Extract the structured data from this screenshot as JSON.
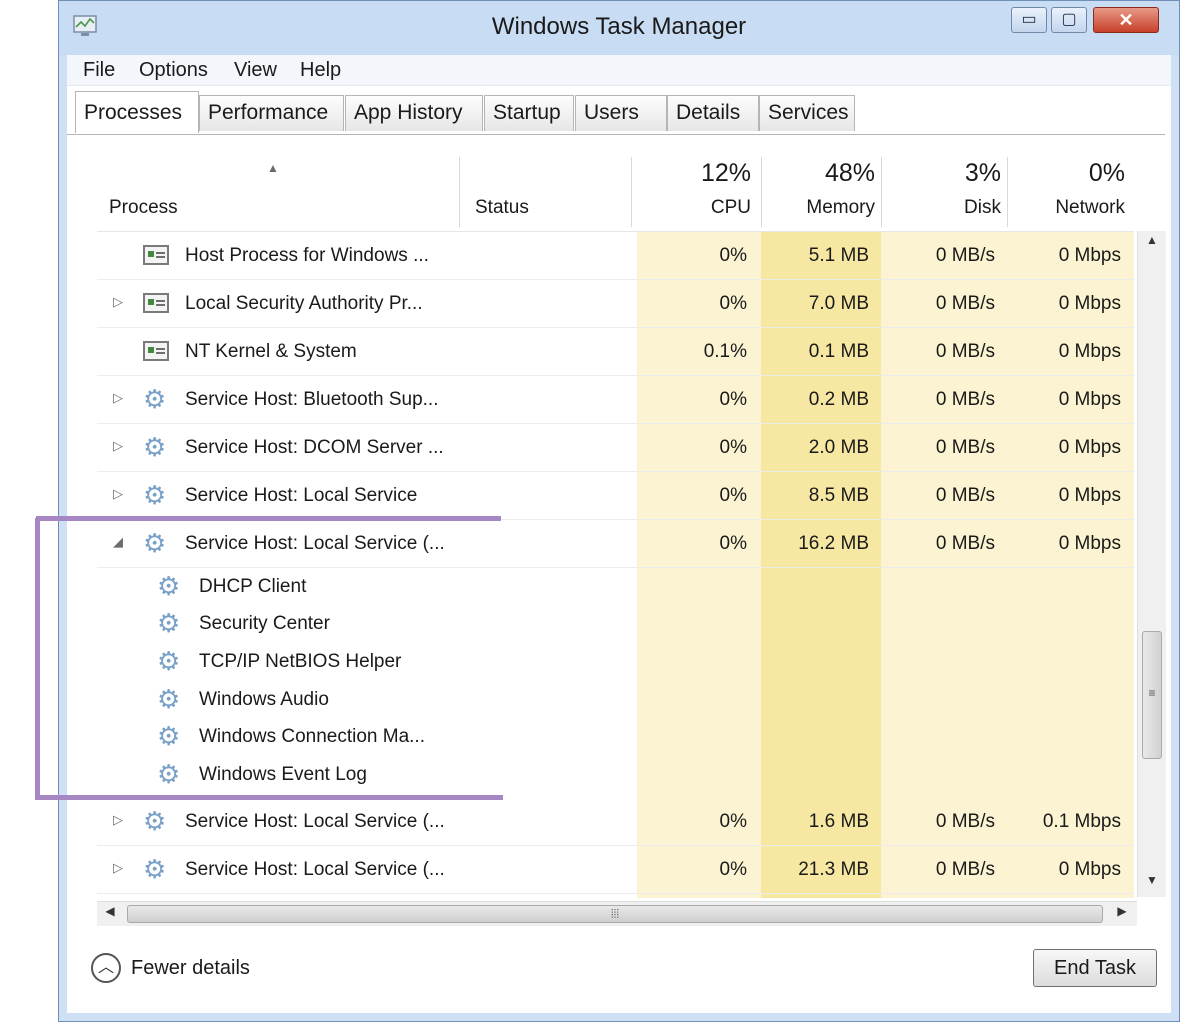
{
  "window": {
    "title": "Windows Task Manager",
    "minimize_icon": "▭",
    "maximize_icon": "▢",
    "close_icon": "✕"
  },
  "menu": [
    {
      "label": "File"
    },
    {
      "label": "Options"
    },
    {
      "label": "View"
    },
    {
      "label": "Help"
    }
  ],
  "tabs": [
    {
      "label": "Processes",
      "active": true
    },
    {
      "label": "Performance"
    },
    {
      "label": "App History"
    },
    {
      "label": "Startup"
    },
    {
      "label": "Users"
    },
    {
      "label": "Details"
    },
    {
      "label": "Services"
    }
  ],
  "columns": {
    "process": "Process",
    "status": "Status",
    "cpu_pct": "12%",
    "cpu": "CPU",
    "mem_pct": "48%",
    "mem": "Memory",
    "disk_pct": "3%",
    "disk": "Disk",
    "net_pct": "0%",
    "net": "Network"
  },
  "rows": [
    {
      "name": "Host Process for Windows ...",
      "icon": "window-icon",
      "expandable": false,
      "cpu": "0%",
      "memory": "5.1 MB",
      "disk": "0 MB/s",
      "network": "0 Mbps"
    },
    {
      "name": "Local Security Authority Pr...",
      "icon": "window-icon",
      "expandable": true,
      "cpu": "0%",
      "memory": "7.0 MB",
      "disk": "0 MB/s",
      "network": "0 Mbps"
    },
    {
      "name": "NT Kernel & System",
      "icon": "window-icon",
      "expandable": false,
      "cpu": "0.1%",
      "memory": "0.1 MB",
      "disk": "0 MB/s",
      "network": "0 Mbps"
    },
    {
      "name": "Service Host: Bluetooth Sup...",
      "icon": "gear-icon",
      "expandable": true,
      "cpu": "0%",
      "memory": "0.2 MB",
      "disk": "0 MB/s",
      "network": "0 Mbps"
    },
    {
      "name": "Service Host: DCOM Server ...",
      "icon": "gear-icon",
      "expandable": true,
      "cpu": "0%",
      "memory": "2.0 MB",
      "disk": "0 MB/s",
      "network": "0 Mbps"
    },
    {
      "name": "Service Host: Local Service",
      "icon": "gear-icon",
      "expandable": true,
      "cpu": "0%",
      "memory": "8.5 MB",
      "disk": "0 MB/s",
      "network": "0 Mbps"
    },
    {
      "name": "Service Host: Local Service (...",
      "icon": "gear-icon",
      "expanded": true,
      "cpu": "0%",
      "memory": "16.2 MB",
      "disk": "0 MB/s",
      "network": "0 Mbps"
    }
  ],
  "children": [
    {
      "name": "DHCP Client"
    },
    {
      "name": "Security Center"
    },
    {
      "name": "TCP/IP NetBIOS Helper"
    },
    {
      "name": "Windows Audio"
    },
    {
      "name": "Windows Connection Ma..."
    },
    {
      "name": "Windows Event Log"
    }
  ],
  "rows_after": [
    {
      "name": "Service Host: Local Service (...",
      "icon": "gear-icon",
      "expandable": true,
      "cpu": "0%",
      "memory": "1.6 MB",
      "disk": "0 MB/s",
      "network": "0.1 Mbps"
    },
    {
      "name": "Service Host: Local Service (...",
      "icon": "gear-icon",
      "expandable": true,
      "cpu": "0%",
      "memory": "21.3 MB",
      "disk": "0 MB/s",
      "network": "0 Mbps"
    }
  ],
  "footer": {
    "fewer_details": "Fewer details",
    "end_task": "End Task"
  },
  "colors": {
    "highlight": "#f6e7a2",
    "light_band": "#fbf3d1",
    "annotation": "#a687c3"
  }
}
